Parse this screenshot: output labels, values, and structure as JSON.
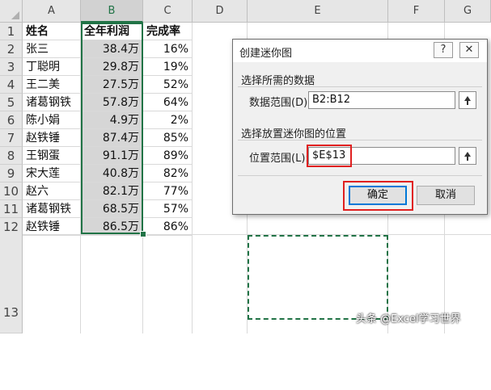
{
  "sheet": {
    "columns": [
      "A",
      "B",
      "C",
      "D",
      "E",
      "F",
      "G"
    ],
    "rows": [
      {
        "num": "1",
        "name": "姓名",
        "profit": "全年利润",
        "rate": "完成率"
      },
      {
        "num": "2",
        "name": "张三",
        "profit": "38.4万",
        "rate": "16%"
      },
      {
        "num": "3",
        "name": "丁聪明",
        "profit": "29.8万",
        "rate": "19%"
      },
      {
        "num": "4",
        "name": "王二美",
        "profit": "27.5万",
        "rate": "52%"
      },
      {
        "num": "5",
        "name": "诸葛钢铁",
        "profit": "57.8万",
        "rate": "64%"
      },
      {
        "num": "6",
        "name": "陈小娟",
        "profit": "4.9万",
        "rate": "2%"
      },
      {
        "num": "7",
        "name": "赵铁锤",
        "profit": "87.4万",
        "rate": "85%"
      },
      {
        "num": "8",
        "name": "王钢蛋",
        "profit": "91.1万",
        "rate": "89%"
      },
      {
        "num": "9",
        "name": "宋大莲",
        "profit": "40.8万",
        "rate": "82%"
      },
      {
        "num": "10",
        "name": "赵六",
        "profit": "82.1万",
        "rate": "77%"
      },
      {
        "num": "11",
        "name": "诸葛钢铁",
        "profit": "68.5万",
        "rate": "57%"
      },
      {
        "num": "12",
        "name": "赵铁锤",
        "profit": "86.5万",
        "rate": "86%"
      }
    ],
    "row13": "13"
  },
  "dialog": {
    "title": "创建迷你图",
    "help_label": "?",
    "close_label": "✕",
    "data_group_label": "选择所需的数据",
    "data_range_label": "数据范围(D):",
    "data_range_value": "B2:B12",
    "location_group_label": "选择放置迷你图的位置",
    "location_range_label": "位置范围(L):",
    "location_range_value": "$E$13",
    "ok_label": "确定",
    "cancel_label": "取消"
  },
  "watermark": "头条 @Excel学习世界",
  "colors": {
    "selection": "#217346",
    "highlight": "#e02020",
    "header_bg": "#e6e6e6"
  }
}
